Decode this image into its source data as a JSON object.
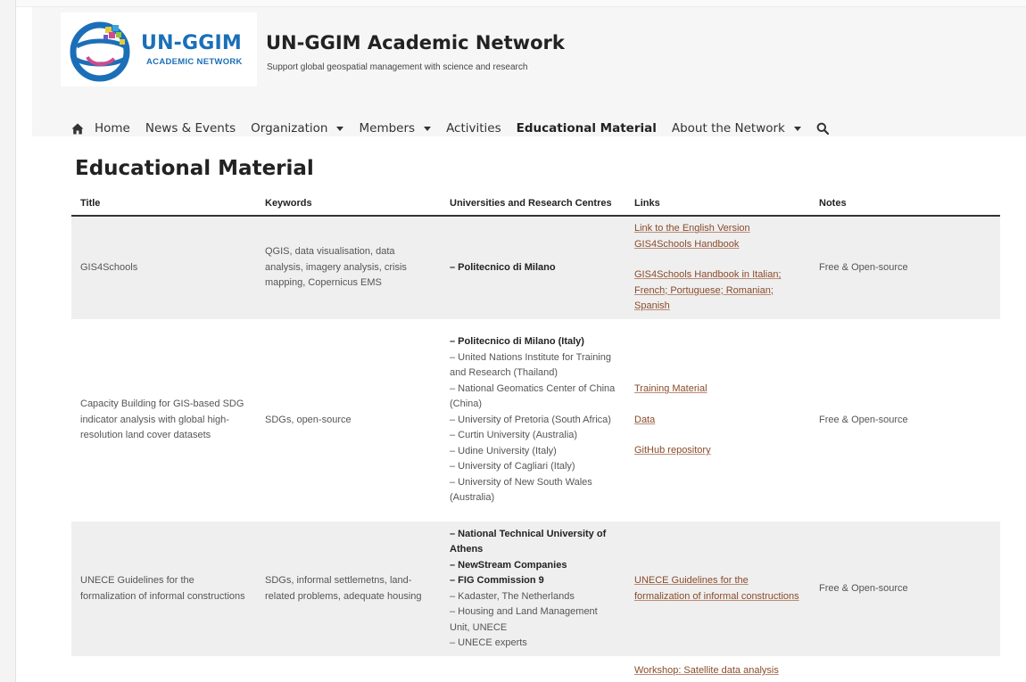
{
  "header": {
    "logo_main": "UN-GGIM",
    "logo_sub": "ACADEMIC NETWORK",
    "site_title": "UN-GGIM Academic Network",
    "tagline": "Support global geospatial management with science and research"
  },
  "nav": {
    "home_icon": "home-icon",
    "items": [
      {
        "label": "Home",
        "dropdown": false
      },
      {
        "label": "News & Events",
        "dropdown": false
      },
      {
        "label": "Organization",
        "dropdown": true
      },
      {
        "label": "Members",
        "dropdown": true
      },
      {
        "label": "Activities",
        "dropdown": false
      },
      {
        "label": "Educational Material",
        "dropdown": false,
        "active": true
      },
      {
        "label": "About the Network",
        "dropdown": true
      }
    ],
    "search_icon": "search-icon"
  },
  "page_title": "Educational Material",
  "table": {
    "headers": [
      "Title",
      "Keywords",
      "Universities and Research Centres",
      "Links",
      "Notes"
    ],
    "rows": [
      {
        "title": "GIS4Schools",
        "keywords": "QGIS, data visualisation, data analysis, imagery analysis, crisis mapping, Copernicus EMS",
        "universities": [
          {
            "text": "– Politecnico di Milano",
            "bold": true
          }
        ],
        "links": [
          "Link to the English Version GIS4Schools Handbook",
          "GIS4Schools Handbook in Italian;  French; Portuguese; Romanian; Spanish"
        ],
        "notes": "Free & Open-source"
      },
      {
        "title": "Capacity Building for GIS-based SDG indicator analysis with global high-resolution land cover datasets",
        "keywords": "SDGs, open-source",
        "universities": [
          {
            "text": "– Politecnico di Milano (Italy)",
            "bold": true
          },
          {
            "text": "– United Nations Institute for Training and Research (Thailand)",
            "bold": false
          },
          {
            "text": "– National Geomatics Center of China (China)",
            "bold": false
          },
          {
            "text": "– University of Pretoria (South Africa)",
            "bold": false
          },
          {
            "text": "– Curtin University (Australia)",
            "bold": false
          },
          {
            "text": "– Udine University (Italy)",
            "bold": false
          },
          {
            "text": "– University of Cagliari (Italy)",
            "bold": false
          },
          {
            "text": "– University of New South Wales (Australia)",
            "bold": false
          }
        ],
        "links": [
          "Training Material",
          "Data",
          "GitHub repository"
        ],
        "notes": "Free & Open-source"
      },
      {
        "title": "UNECE Guidelines for the formalization of informal constructions",
        "keywords": "SDGs, informal settlemetns, land-related problems, adequate housing",
        "universities": [
          {
            "text": "– National Technical University of Athens",
            "bold": true
          },
          {
            "text": "– NewStream Companies",
            "bold": true
          },
          {
            "text": "– FIG Commission 9",
            "bold": true
          },
          {
            "text": "– Kadaster, The Netherlands",
            "bold": false
          },
          {
            "text": "– Housing and Land Management Unit, UNECE",
            "bold": false
          },
          {
            "text": "– UNECE experts",
            "bold": false
          }
        ],
        "links": [
          "UNECE Guidelines for the formalization of informal constructions"
        ],
        "notes": "Free & Open-source"
      },
      {
        "title": "",
        "keywords": "",
        "universities": [],
        "links": [
          "Workshop: Satellite data analysis"
        ],
        "notes": ""
      }
    ]
  },
  "colors": {
    "logo_blue": "#1b6fb8",
    "link": "#8a4b2a",
    "row_shade": "#efefef",
    "header_bg": "#f6f6f6"
  }
}
